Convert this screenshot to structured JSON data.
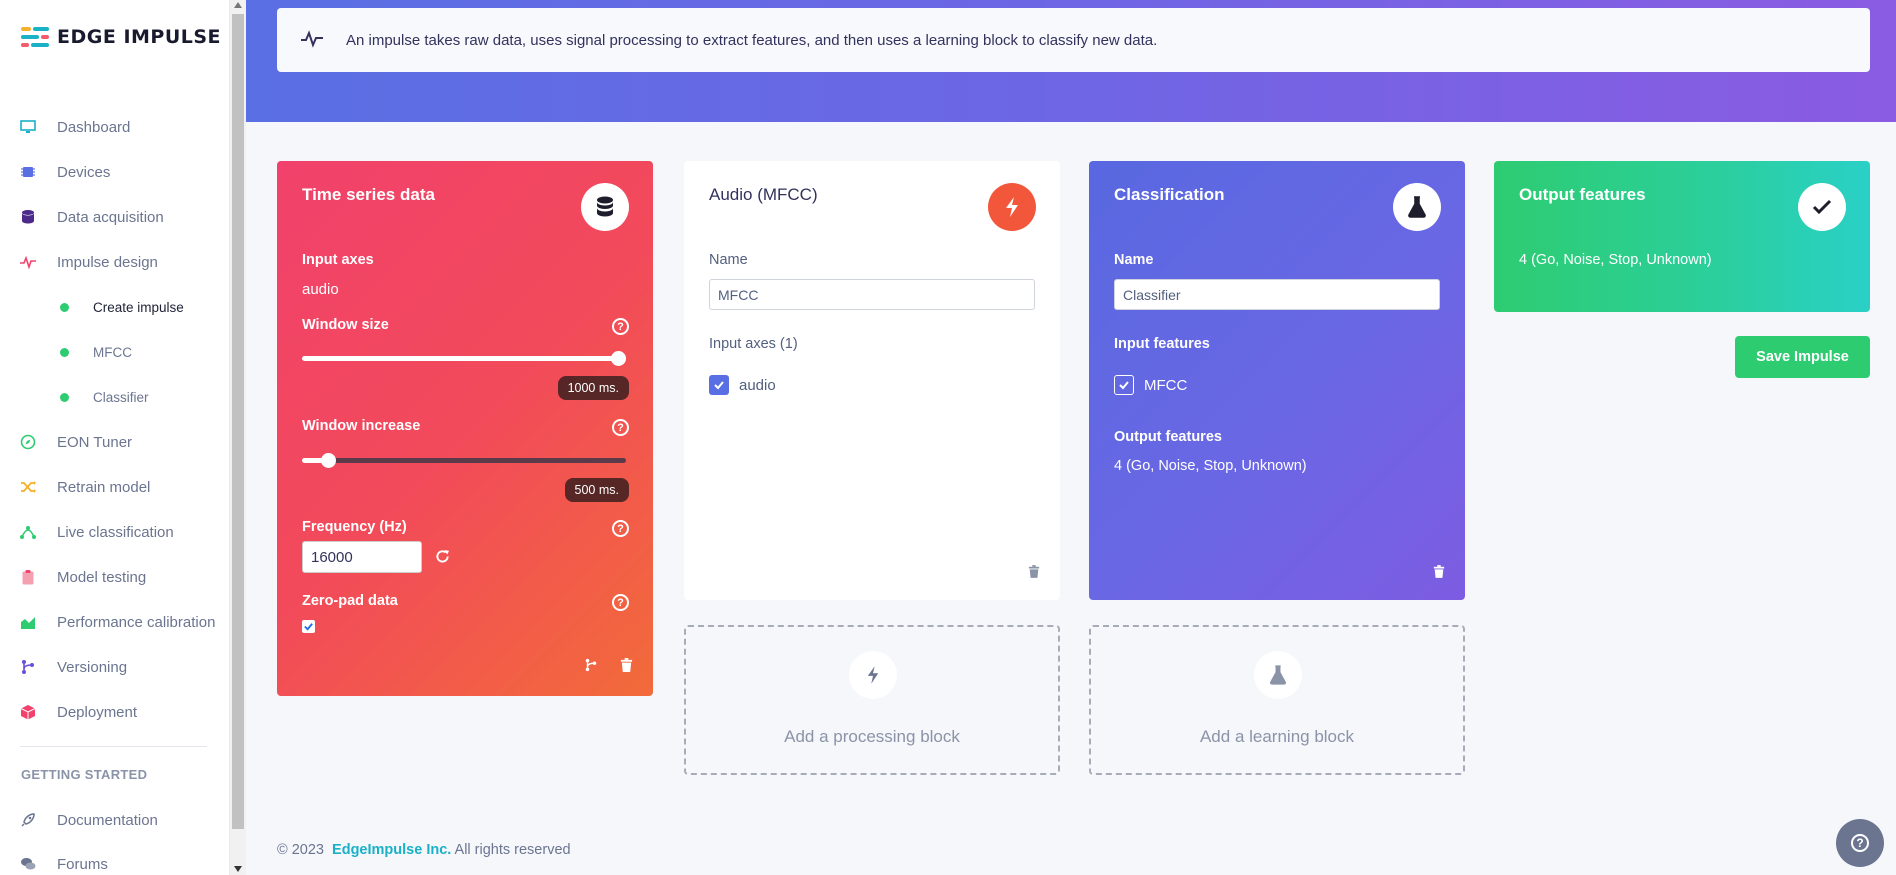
{
  "brand": {
    "name": "EDGE IMPULSE",
    "colors": {
      "accent": "#5a6fe3",
      "green": "#2ecc71",
      "red": "#f1416c"
    }
  },
  "sidebar": {
    "items": [
      {
        "label": "Dashboard",
        "icon": "monitor-icon"
      },
      {
        "label": "Devices",
        "icon": "chip-icon"
      },
      {
        "label": "Data acquisition",
        "icon": "database-icon"
      },
      {
        "label": "Impulse design",
        "icon": "pulse-icon"
      },
      {
        "label": "Create impulse",
        "sub": true,
        "active": true
      },
      {
        "label": "MFCC",
        "sub": true
      },
      {
        "label": "Classifier",
        "sub": true
      },
      {
        "label": "EON Tuner",
        "icon": "compass-icon"
      },
      {
        "label": "Retrain model",
        "icon": "shuffle-icon"
      },
      {
        "label": "Live classification",
        "icon": "nodes-icon"
      },
      {
        "label": "Model testing",
        "icon": "clipboard-icon"
      },
      {
        "label": "Performance calibration",
        "icon": "chart-icon"
      },
      {
        "label": "Versioning",
        "icon": "branch-icon"
      },
      {
        "label": "Deployment",
        "icon": "box-icon"
      }
    ],
    "section_title": "GETTING STARTED",
    "extra": [
      {
        "label": "Documentation",
        "icon": "rocket-icon"
      },
      {
        "label": "Forums",
        "icon": "chat-icon"
      }
    ]
  },
  "info": {
    "text": "An impulse takes raw data, uses signal processing to extract features, and then uses a learning block to classify new data."
  },
  "time_series": {
    "title": "Time series data",
    "input_axes_label": "Input axes",
    "input_axes_value": "audio",
    "window_size_label": "Window size",
    "window_size_value": "1000 ms.",
    "window_size_fraction": 1.0,
    "window_increase_label": "Window increase",
    "window_increase_value": "500 ms.",
    "window_increase_fraction": 0.06,
    "frequency_label": "Frequency (Hz)",
    "frequency_value": "16000",
    "zero_pad_label": "Zero-pad data",
    "zero_pad_checked": true
  },
  "mfcc": {
    "title": "Audio (MFCC)",
    "name_label": "Name",
    "name_value": "MFCC",
    "input_axes_label": "Input axes (1)",
    "axis_option": "audio"
  },
  "classification": {
    "title": "Classification",
    "name_label": "Name",
    "name_value": "Classifier",
    "input_features_label": "Input features",
    "feature_option": "MFCC",
    "output_features_label": "Output features",
    "output_features_value": "4 (Go, Noise, Stop, Unknown)"
  },
  "output": {
    "title": "Output features",
    "value": "4 (Go, Noise, Stop, Unknown)"
  },
  "add_processing": "Add a processing block",
  "add_learning": "Add a learning block",
  "save_label": "Save Impulse",
  "footer": {
    "copy": "© 2023",
    "company": "EdgeImpulse Inc.",
    "rights": "All rights reserved"
  }
}
